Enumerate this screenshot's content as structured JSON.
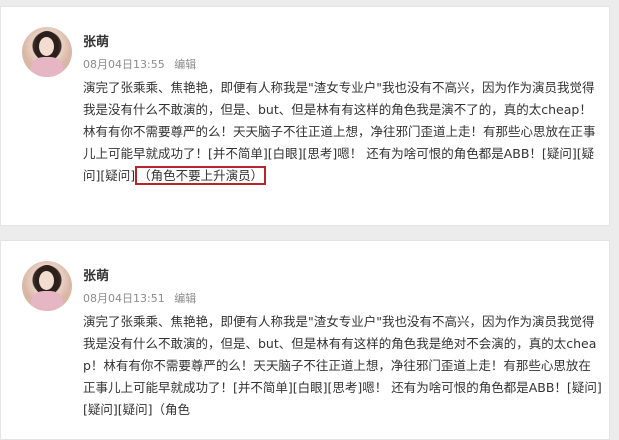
{
  "posts": [
    {
      "username": "张萌",
      "timestamp": "08月04日13:55",
      "edit_label": "编辑",
      "content": "演完了张乘乘、焦艳艳，即便有人称我是\"渣女专业户\"我也没有不高兴，因为作为演员我觉得我是没有什么不敢演的，但是、but、但是林有有这样的角色我是演不了的，真的太cheap！林有有你不需要尊严的么！天天脑子不往正道上想，净往邪门歪道上走！有那些心思放在正事儿上可能早就成功了！[并不简单][白眼][思考]嗯！ 还有为啥可恨的角色都是ABB！[疑问][疑问][疑问]",
      "highlight": "（角色不要上升演员）"
    },
    {
      "username": "张萌",
      "timestamp": "08月04日13:51",
      "edit_label": "编辑",
      "content": "演完了张乘乘、焦艳艳，即便有人称我是\"渣女专业户\"我也没有不高兴，因为作为演员我觉得我是没有什么不敢演的，但是、but、但是林有有这样的角色我是绝对不会演的，真的太cheap！林有有你不需要尊严的么！天天脑子不往正道上想，净往邪门歪道上走！有那些心思放在正事儿上可能早就成功了！[并不简单][白眼][思考]嗯！ 还有为啥可恨的角色都是ABB！[疑问][疑问][疑问]（角色"
    }
  ],
  "colors": {
    "highlight_border": "#b8252a",
    "text": "#333333",
    "meta": "#8c8c8c",
    "background": "#ececec"
  }
}
